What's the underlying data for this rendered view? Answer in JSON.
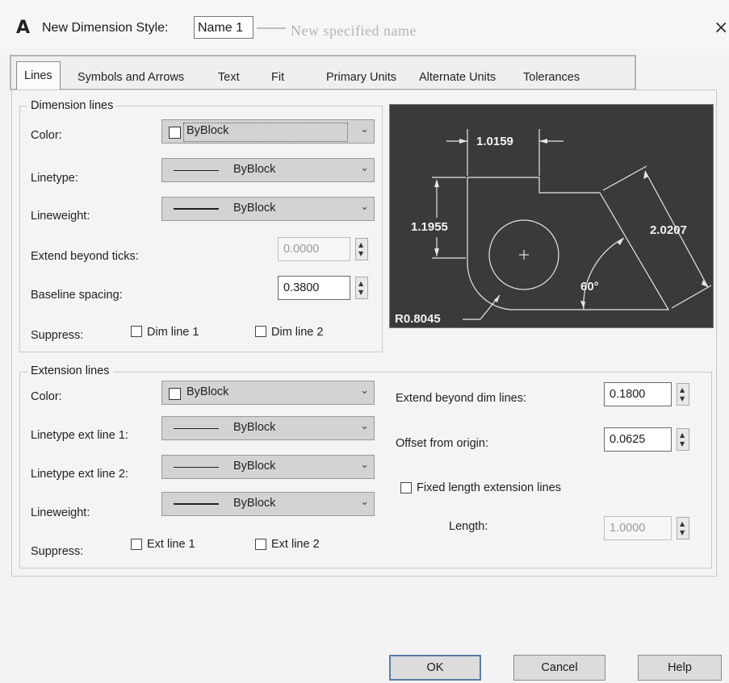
{
  "window": {
    "icon": "autocad-a-icon",
    "title_prefix": "New Dimension Style:",
    "style_name": "Name 1",
    "annotation": "New specified name",
    "close_glyph": "×"
  },
  "tabs": [
    {
      "label": "Lines",
      "active": true
    },
    {
      "label": "Symbols and Arrows"
    },
    {
      "label": "Text"
    },
    {
      "label": "Fit"
    },
    {
      "label": "Primary Units"
    },
    {
      "label": "Alternate Units"
    },
    {
      "label": "Tolerances"
    }
  ],
  "dimension_lines": {
    "group_title": "Dimension lines",
    "color_label": "Color:",
    "color_value": "ByBlock",
    "linetype_label": "Linetype:",
    "linetype_value": "ByBlock",
    "lineweight_label": "Lineweight:",
    "lineweight_value": "ByBlock",
    "extend_label": "Extend beyond ticks:",
    "extend_value": "0.0000",
    "baseline_label": "Baseline spacing:",
    "baseline_value": "0.3800",
    "suppress_label": "Suppress:",
    "dim_line1": "Dim line 1",
    "dim_line2": "Dim line 2"
  },
  "extension_lines": {
    "group_title": "Extension lines",
    "color_label": "Color:",
    "color_value": "ByBlock",
    "linetype1_label": "Linetype ext line 1:",
    "linetype1_value": "ByBlock",
    "linetype2_label": "Linetype ext line 2:",
    "linetype2_value": "ByBlock",
    "lineweight_label": "Lineweight:",
    "lineweight_value": "ByBlock",
    "suppress_label": "Suppress:",
    "ext_line1": "Ext line 1",
    "ext_line2": "Ext line 2",
    "extend_beyond_label": "Extend beyond dim lines:",
    "extend_beyond_value": "0.1800",
    "offset_label": "Offset from origin:",
    "offset_value": "0.0625",
    "fixed_length_label": "Fixed length extension lines",
    "length_label": "Length:",
    "length_value": "1.0000"
  },
  "preview": {
    "dim_top": "1.0159",
    "dim_left": "1.1955",
    "dim_right": "2.0207",
    "dim_angle": "60°",
    "dim_radius": "R0.8045"
  },
  "buttons": {
    "ok": "OK",
    "cancel": "Cancel",
    "help": "Help"
  },
  "colors": {
    "preview_bg": "#3a3a3a",
    "preview_lines": "#e6e6e6",
    "combo_bg": "#d3d3d3",
    "ok_border": "#5a7da8"
  }
}
